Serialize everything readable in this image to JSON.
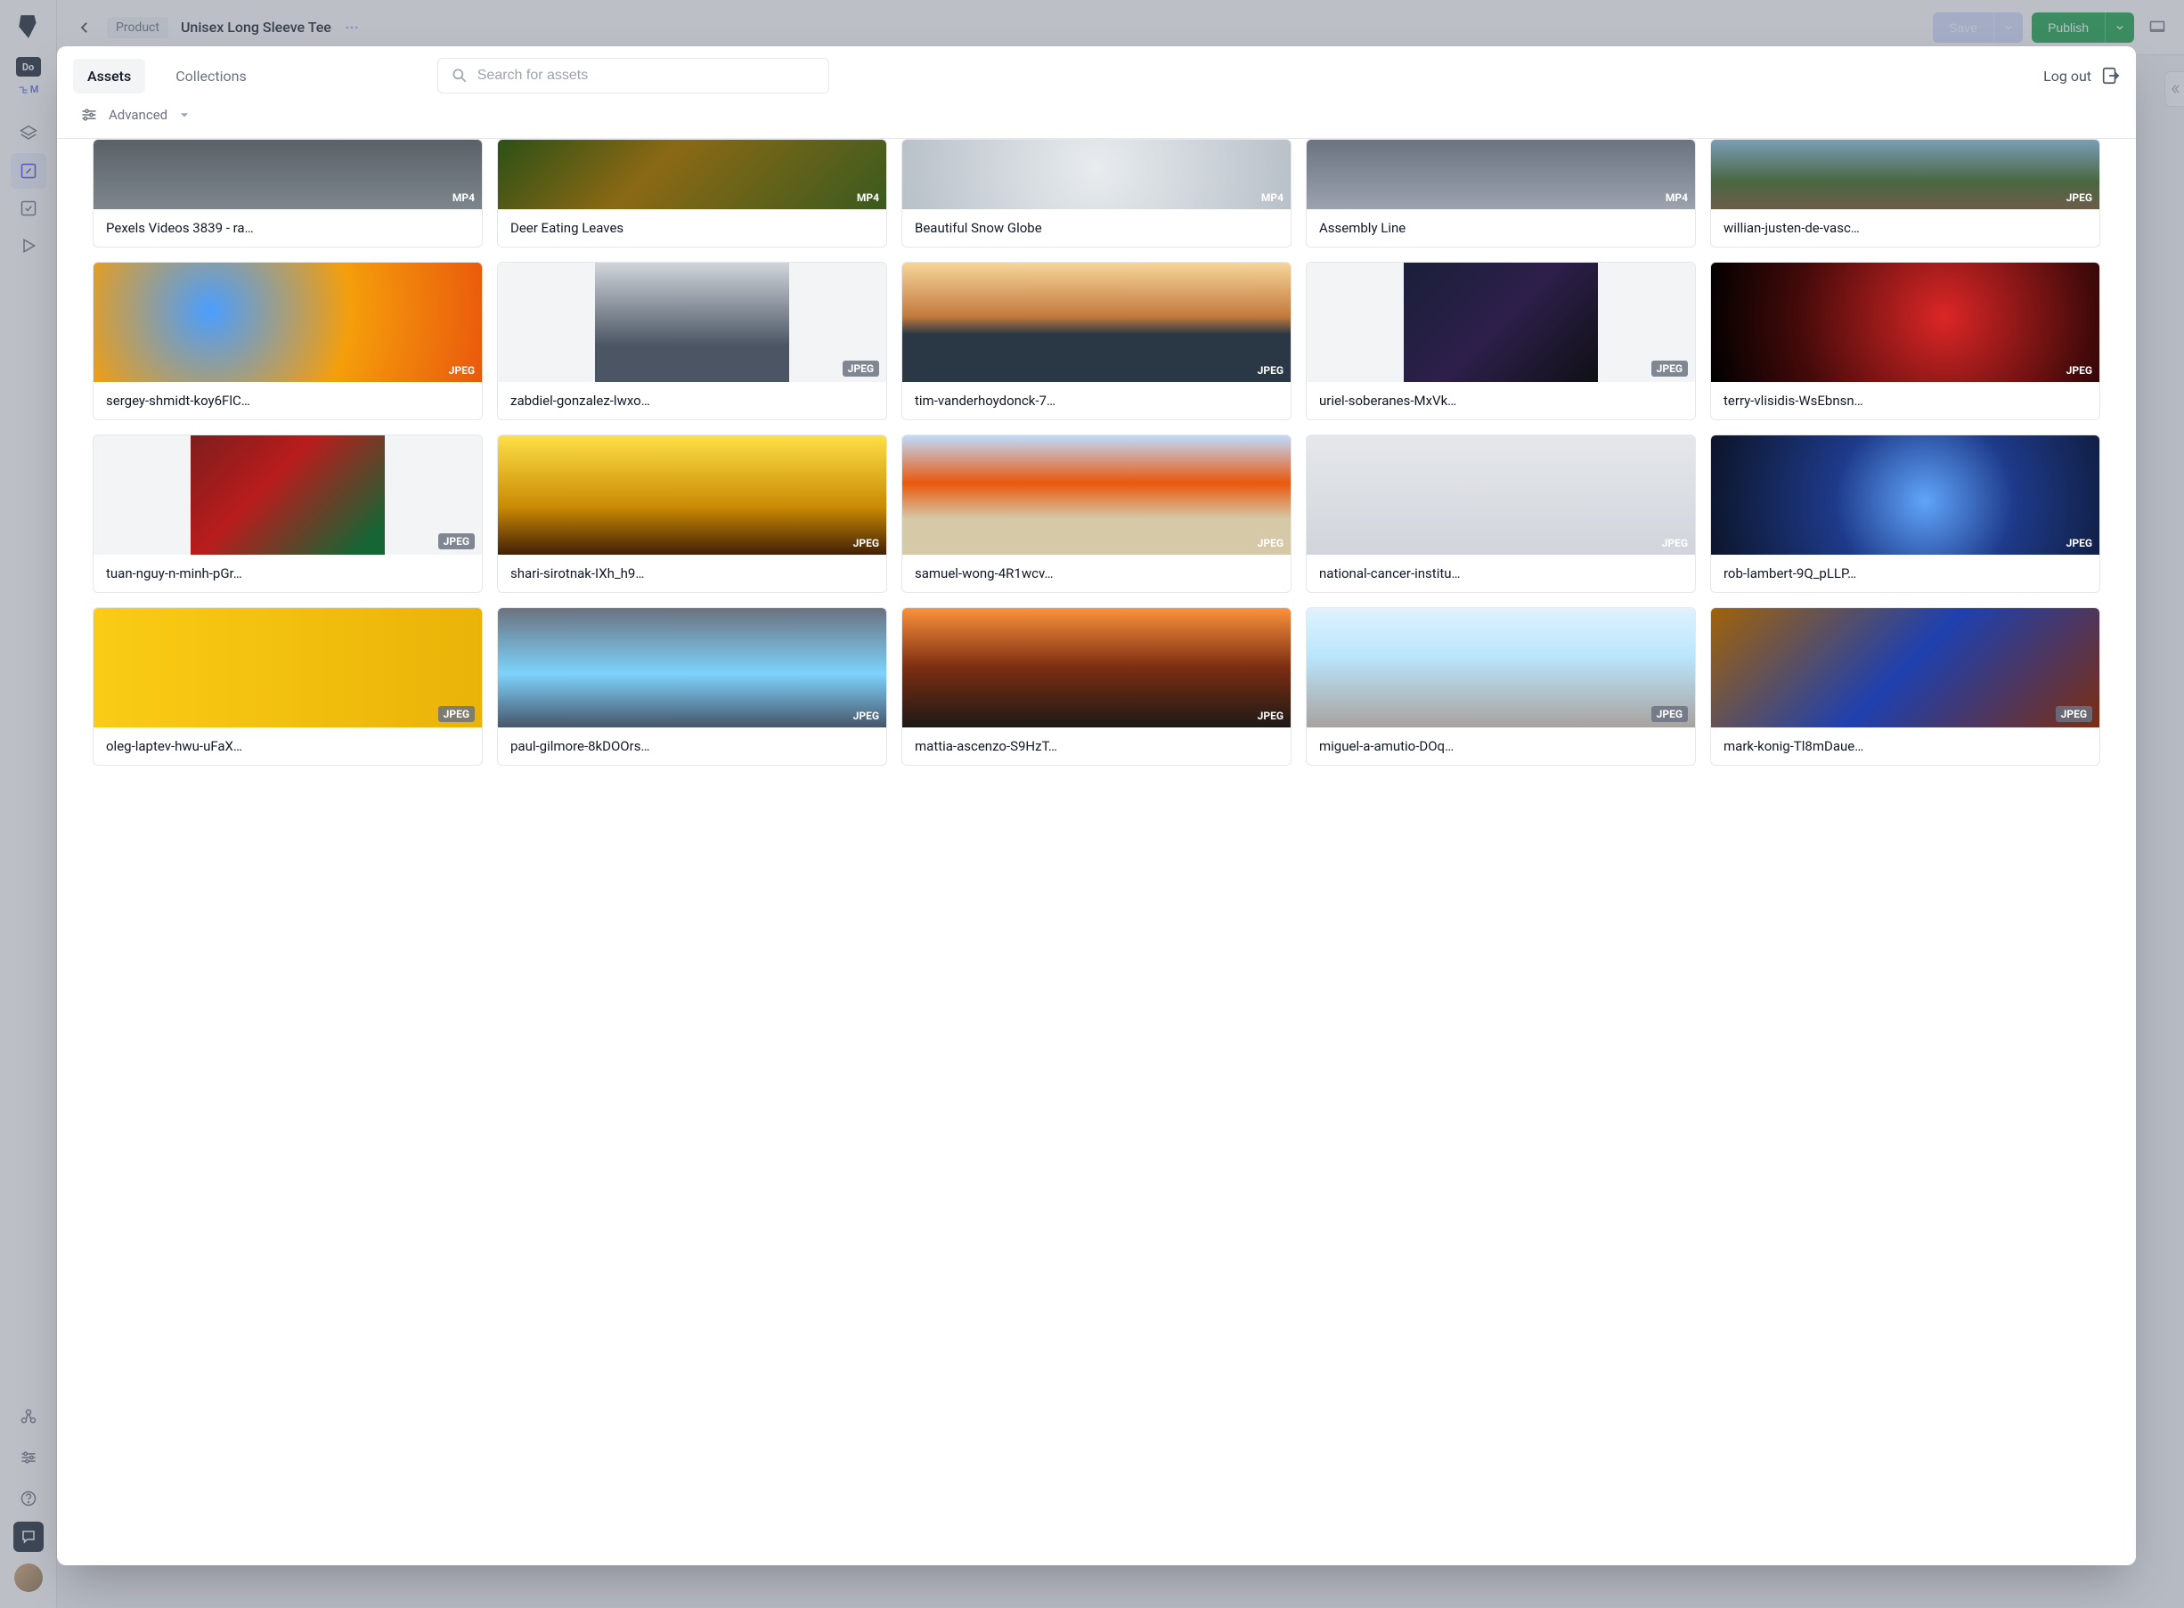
{
  "sidebar": {
    "workspace_chip": "Do",
    "branch": "M"
  },
  "topbar": {
    "crumb_chip": "Product",
    "crumb_title": "Unisex Long Sleeve Tee",
    "save_label": "Save",
    "publish_label": "Publish"
  },
  "modal": {
    "tabs": {
      "assets": "Assets",
      "collections": "Collections"
    },
    "search_placeholder": "Search for assets",
    "logout_label": "Log out",
    "advanced_label": "Advanced"
  },
  "assets": [
    {
      "title": "Pexels Videos 3839 - ra…",
      "type": "MP4",
      "chip": false,
      "bg": "linear-gradient(180deg,#5a6268,#7d868c)",
      "portrait": false
    },
    {
      "title": "Deer Eating Leaves",
      "type": "MP4",
      "chip": false,
      "bg": "linear-gradient(135deg,#2d5016,#8b6914 40%,#3a5a1f)",
      "portrait": false
    },
    {
      "title": "Beautiful Snow Globe",
      "type": "MP4",
      "chip": false,
      "bg": "radial-gradient(circle at 50% 40%,#e8ecef,#b8c0c8)",
      "portrait": false
    },
    {
      "title": "Assembly Line",
      "type": "MP4",
      "chip": false,
      "bg": "linear-gradient(180deg,#6b7280,#9ca3af)",
      "portrait": false
    },
    {
      "title": "willian-justen-de-vasc…",
      "type": "JPEG",
      "chip": false,
      "bg": "linear-gradient(180deg,#7a9eb8,#4a6741 60%,#6b5d4a)",
      "portrait": false
    },
    {
      "title": "sergey-shmidt-koy6FlC…",
      "type": "JPEG",
      "chip": false,
      "bg": "radial-gradient(circle at 30% 40%,#4a9eff,#f59e0b 50%,#ea580c)",
      "portrait": false
    },
    {
      "title": "zabdiel-gonzalez-lwxo…",
      "type": "JPEG",
      "chip": true,
      "bg": "linear-gradient(180deg,#d1d5db,#4b5563 70%)",
      "portrait": true
    },
    {
      "title": "tim-vanderhoydonck-7…",
      "type": "JPEG",
      "chip": false,
      "bg": "linear-gradient(180deg,#f5d59a,#c47a3d 45%,#2a3845 60%)",
      "portrait": false
    },
    {
      "title": "uriel-soberanes-MxVk…",
      "type": "JPEG",
      "chip": true,
      "bg": "linear-gradient(135deg,#1a1f3a,#2d1f4a 50%,#0f1015)",
      "portrait": true
    },
    {
      "title": "terry-vlisidis-WsEbnsn…",
      "type": "JPEG",
      "chip": false,
      "bg": "radial-gradient(circle at 60% 45%,#dc2626,#450a0a 60%,#000)",
      "portrait": false
    },
    {
      "title": "tuan-nguy-n-minh-pGr…",
      "type": "JPEG",
      "chip": true,
      "bg": "linear-gradient(135deg,#7f1d1d,#b91c1c 40%,#166534 90%)",
      "portrait": true
    },
    {
      "title": "shari-sirotnak-IXh_h9…",
      "type": "JPEG",
      "chip": false,
      "bg": "linear-gradient(180deg,#fde047,#ca8a04 60%,#422006)",
      "portrait": false
    },
    {
      "title": "samuel-wong-4R1wcv…",
      "type": "JPEG",
      "chip": false,
      "bg": "linear-gradient(180deg,#bfdbfe,#ea580c 40%,#d6c9a8 70%)",
      "portrait": false
    },
    {
      "title": "national-cancer-institu…",
      "type": "JPEG",
      "chip": false,
      "bg": "linear-gradient(180deg,#e5e7eb,#d1d5db)",
      "portrait": false
    },
    {
      "title": "rob-lambert-9Q_pLLP…",
      "type": "JPEG",
      "chip": false,
      "bg": "radial-gradient(circle at 55% 55%,#60a5fa,#1e3a8a 40%,#0c1428)",
      "portrait": false
    },
    {
      "title": "oleg-laptev-hwu-uFaX…",
      "type": "JPEG",
      "chip": true,
      "bg": "linear-gradient(90deg,#facc15,#eab308)",
      "portrait": false
    },
    {
      "title": "paul-gilmore-8kDOOrs…",
      "type": "JPEG",
      "chip": false,
      "bg": "linear-gradient(180deg,#6b7280,#7dd3fc 55%,#475569)",
      "portrait": false
    },
    {
      "title": "mattia-ascenzo-S9HzT…",
      "type": "JPEG",
      "chip": false,
      "bg": "linear-gradient(180deg,#fb923c,#7c2d12 50%,#1c1917)",
      "portrait": false
    },
    {
      "title": "miguel-a-amutio-DOq…",
      "type": "JPEG",
      "chip": true,
      "bg": "linear-gradient(180deg,#e0f2fe,#bae6fd 40%,#a8a29e)",
      "portrait": false
    },
    {
      "title": "mark-konig-Tl8mDaue…",
      "type": "JPEG",
      "chip": true,
      "bg": "linear-gradient(135deg,#a16207,#1e40af 50%,#7c2d12)",
      "portrait": false
    }
  ]
}
